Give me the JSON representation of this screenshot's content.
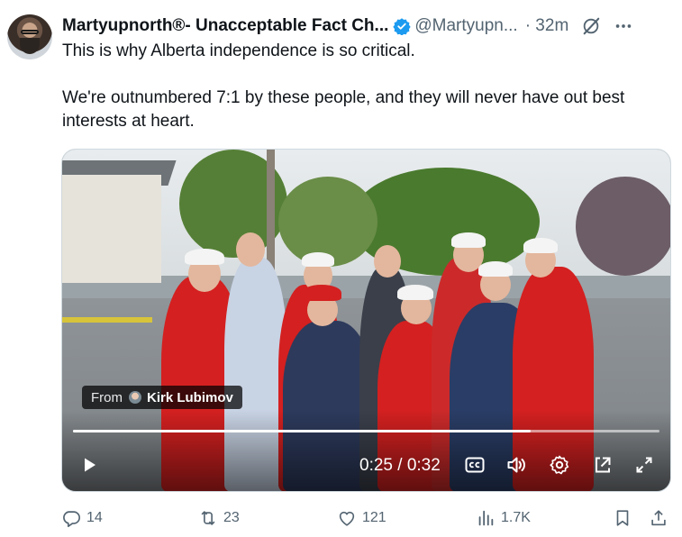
{
  "post": {
    "display_name": "Martyupnorth®- Unacceptable Fact Ch...",
    "handle": "@Martyupn...",
    "time": "· 32m",
    "text_line1": "This is why Alberta independence is so critical.",
    "text_line2": "We're outnumbered 7:1 by these people, and they will never have out best interests at heart."
  },
  "video": {
    "from_label": "From",
    "from_name": "Kirk Lubimov",
    "time_display": "0:25 / 0:32",
    "progress": 0.78
  },
  "actions": {
    "replies": "14",
    "reposts": "23",
    "likes": "121",
    "views": "1.7K"
  },
  "colors": {
    "text": "#0f1419",
    "muted": "#536471",
    "verified": "#1d9bf0"
  },
  "icons": [
    "verified-badge-icon",
    "grok-icon",
    "more-icon",
    "play-icon",
    "captions-icon",
    "volume-icon",
    "settings-icon",
    "pop-out-icon",
    "fullscreen-icon",
    "reply-icon",
    "repost-icon",
    "like-icon",
    "views-icon",
    "bookmark-icon",
    "share-icon"
  ]
}
